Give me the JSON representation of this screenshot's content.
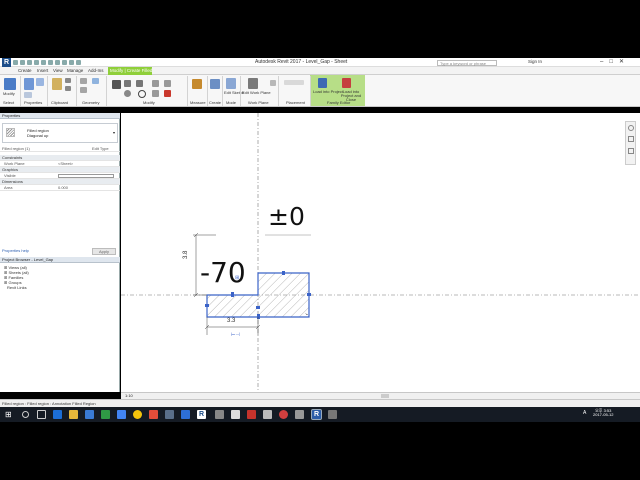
{
  "window": {
    "title": "Autodesk Revit 2017 -    Level_Gap - Sheet",
    "logo": "R",
    "search_placeholder": "Type a keyword or phrase",
    "signin": "Sign In"
  },
  "ribbon": {
    "tabs": [
      "Create",
      "Insert",
      "View",
      "Manage",
      "Add-Ins"
    ],
    "active_tab": "Modify | Create Filled Region Boundary",
    "panels": [
      "Select",
      "Properties",
      "Clipboard",
      "Geometry",
      "Modify",
      "Measure",
      "Create",
      "Mode",
      "Work Plane",
      "Placement",
      "Family Editor"
    ],
    "buttons": {
      "modify": "Modify",
      "edit_sketch": "Edit Sketch",
      "edit_work_plane": "Edit Work Plane",
      "load_into_project": "Load into Project",
      "load_into_project_close": "Load into Project and Close"
    }
  },
  "properties": {
    "header": "Properties",
    "type_name": "Filled region",
    "type_sub": "Diagonal up",
    "instance": "Filled region (1)",
    "edit_type": "Edit Type",
    "groups": [
      "Constraints",
      "Graphics",
      "Dimensions"
    ],
    "rows": [
      {
        "label": "Work Plane",
        "value": "<Sheet>"
      },
      {
        "label": "Visible",
        "value": ""
      },
      {
        "label": "Area",
        "value": "0.000"
      }
    ],
    "help_link": "Properties help",
    "apply": "Apply"
  },
  "browser": {
    "header": "Project Browser - Level_Gap",
    "items": [
      "Views (all)",
      "Sheets (all)",
      "Families",
      "Groups",
      "Revit Links"
    ]
  },
  "canvas": {
    "label_zero": "±0",
    "label_minus70": "-70",
    "dim_vertical": "3.8",
    "dim_horizontal": "3.3"
  },
  "view_control": {
    "scale": "1:10"
  },
  "status": {
    "text": "Filled region : Filled region : Annotation Filled Region"
  },
  "taskbar": {
    "clock_time": "오후 3:53",
    "clock_date": "2017-05-12",
    "lang": "A"
  },
  "colors": {
    "ribbon_accent": "#8fcf3a",
    "finish_panel": "#b7de87",
    "sketch_line": "#3b63c8",
    "taskbar": "#151b24"
  }
}
